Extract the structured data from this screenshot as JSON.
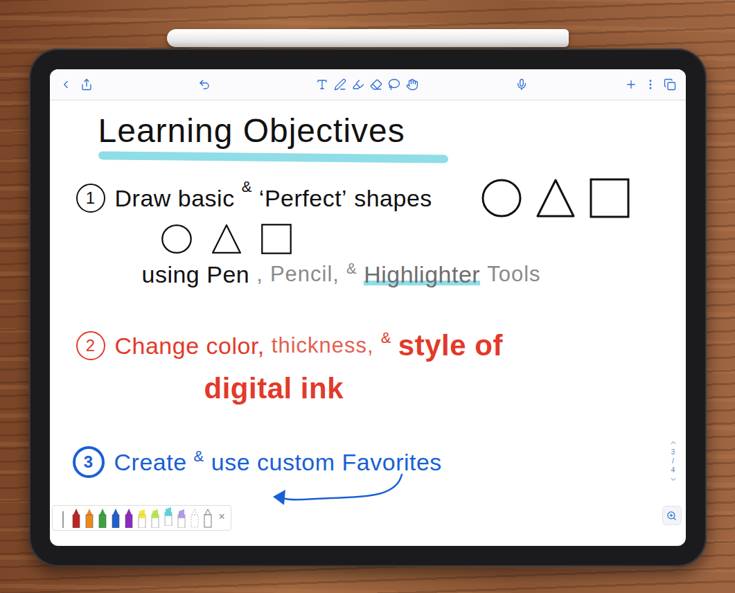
{
  "title": "Learning Objectives",
  "objectives": [
    {
      "number": "1",
      "color": "#111111",
      "badge": "outline",
      "lines": [
        {
          "segments": [
            {
              "text": "Draw basic",
              "kind": "plain",
              "color": "#111111"
            },
            {
              "text": "&",
              "kind": "small",
              "color": "#111111"
            },
            {
              "text": "‘Perfect’",
              "kind": "plain",
              "color": "#111111"
            },
            {
              "text": "shapes",
              "kind": "plain",
              "color": "#111111"
            }
          ],
          "figures": [
            {
              "kind": "circle"
            },
            {
              "kind": "triangle"
            },
            {
              "kind": "square"
            }
          ]
        },
        {
          "segments": [],
          "figures": [
            {
              "kind": "circle"
            },
            {
              "kind": "triangle"
            },
            {
              "kind": "square"
            }
          ]
        },
        {
          "segments": [
            {
              "text": "using",
              "kind": "plain",
              "color": "#111111"
            },
            {
              "text": "Pen",
              "kind": "plain",
              "color": "#111111"
            },
            {
              "text": ",",
              "kind": "thin",
              "color": "#8a8a8a"
            },
            {
              "text": "Pencil,",
              "kind": "thin",
              "color": "#8a8a8a"
            },
            {
              "text": "&",
              "kind": "small",
              "color": "#8a8a8a"
            },
            {
              "text": "Highlighter",
              "kind": "highlight",
              "color": "#6f6f6f"
            },
            {
              "text": "Tools",
              "kind": "thin",
              "color": "#8a8a8a"
            }
          ],
          "figures": []
        }
      ]
    },
    {
      "number": "2",
      "color": "#e23a2a",
      "badge": "outline",
      "lines": [
        {
          "segments": [
            {
              "text": "Change color,",
              "kind": "plain",
              "color": "#e23a2a"
            },
            {
              "text": "thickness,",
              "kind": "thin",
              "color": "#e2604f"
            },
            {
              "text": "&",
              "kind": "small",
              "color": "#e23a2a"
            },
            {
              "text": "style of",
              "kind": "bold",
              "color": "#e23a2a"
            }
          ],
          "figures": []
        },
        {
          "segments": [
            {
              "text": "digital ink",
              "kind": "bold",
              "color": "#e23a2a"
            }
          ],
          "figures": []
        }
      ]
    },
    {
      "number": "3",
      "color": "#1a5fd6",
      "badge": "bold",
      "lines": [
        {
          "segments": [
            {
              "text": "Create",
              "kind": "plain",
              "color": "#1a5fd6"
            },
            {
              "text": "&",
              "kind": "small",
              "color": "#1a5fd6"
            },
            {
              "text": "use custom Favorites",
              "kind": "plain",
              "color": "#1a5fd6"
            }
          ],
          "figures": []
        }
      ]
    }
  ],
  "page_indicator": {
    "current": "3",
    "separator": "/",
    "total": "4"
  },
  "favorites": {
    "items": [
      {
        "kind": "thin",
        "color": "#9a9a9a",
        "selected": false
      },
      {
        "kind": "pen",
        "color": "#c0231f",
        "selected": false
      },
      {
        "kind": "pen",
        "color": "#f08a1c",
        "selected": false
      },
      {
        "kind": "pen",
        "color": "#3ca33c",
        "selected": false
      },
      {
        "kind": "pen",
        "color": "#1f5fd1",
        "selected": false
      },
      {
        "kind": "pen",
        "color": "#8a2bc0",
        "selected": false
      },
      {
        "kind": "highlighter",
        "color": "#f2e640",
        "selected": false
      },
      {
        "kind": "highlighter",
        "color": "#b6e84a",
        "selected": false
      },
      {
        "kind": "highlighter",
        "color": "#5fd3e0",
        "selected": true
      },
      {
        "kind": "highlighter",
        "color": "#b49be6",
        "selected": false
      },
      {
        "kind": "dashed",
        "color": "#bbbbbb",
        "selected": false
      },
      {
        "kind": "outline",
        "color": "#ffffff",
        "selected": false
      }
    ],
    "close": "×"
  }
}
